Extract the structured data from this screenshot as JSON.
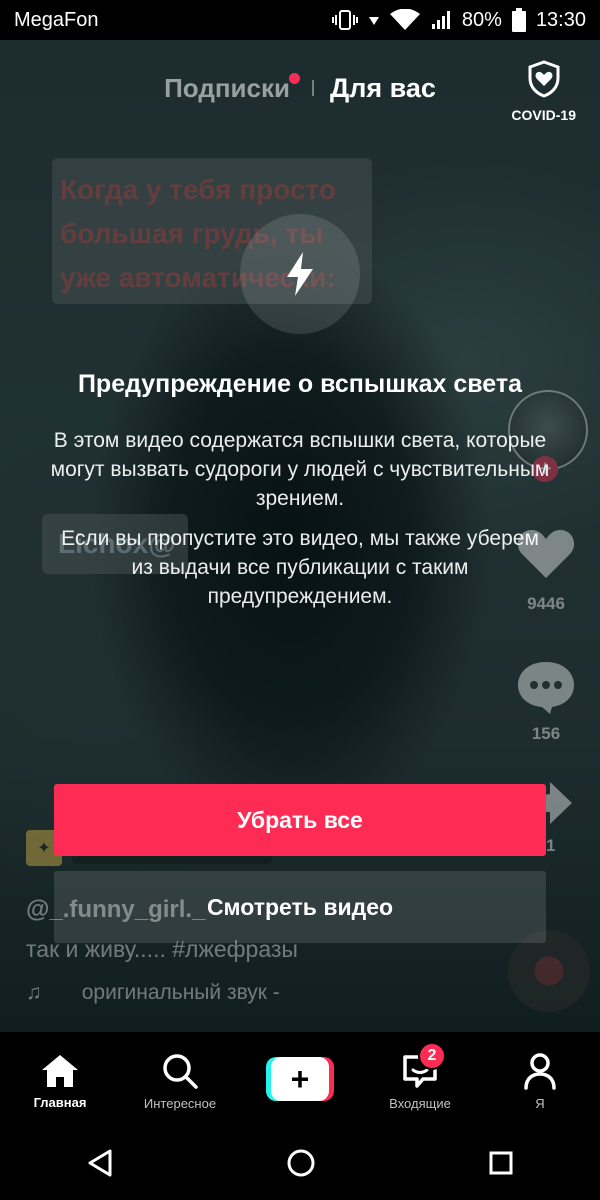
{
  "status_bar": {
    "carrier": "MegaFon",
    "battery": "80%",
    "time": "13:30"
  },
  "top_nav": {
    "following": "Подписки",
    "for_you": "Для вас",
    "covid": "COVID-19"
  },
  "video": {
    "caption_lines": [
      "Когда у тебя просто",
      "большая грудь, ты",
      "уже автоматически:"
    ],
    "overlay_username": "Lichox@",
    "likes": "9446",
    "comments": "156",
    "shares": "21",
    "author": "@_.funny_girl._",
    "description": "так и живу..... #лжефразы",
    "sound": "оригинальный звук -"
  },
  "warning": {
    "title": "Предупреждение о вспышках света",
    "paragraph1": "В этом видео содержатся вспышки света, которые могут вызвать судороги у людей с чувствительным зрением.",
    "paragraph2": "Если вы пропустите это видео, мы также уберем из выдачи все публикации с таким предупреждением.",
    "primary_button": "Убрать все",
    "secondary_button": "Смотреть видео"
  },
  "tab_bar": {
    "home": "Главная",
    "discover": "Интересное",
    "create": "+",
    "inbox": "Входящие",
    "inbox_badge": "2",
    "profile": "Я"
  },
  "colors": {
    "accent": "#fe2c55",
    "cyan": "#25f4ee"
  }
}
